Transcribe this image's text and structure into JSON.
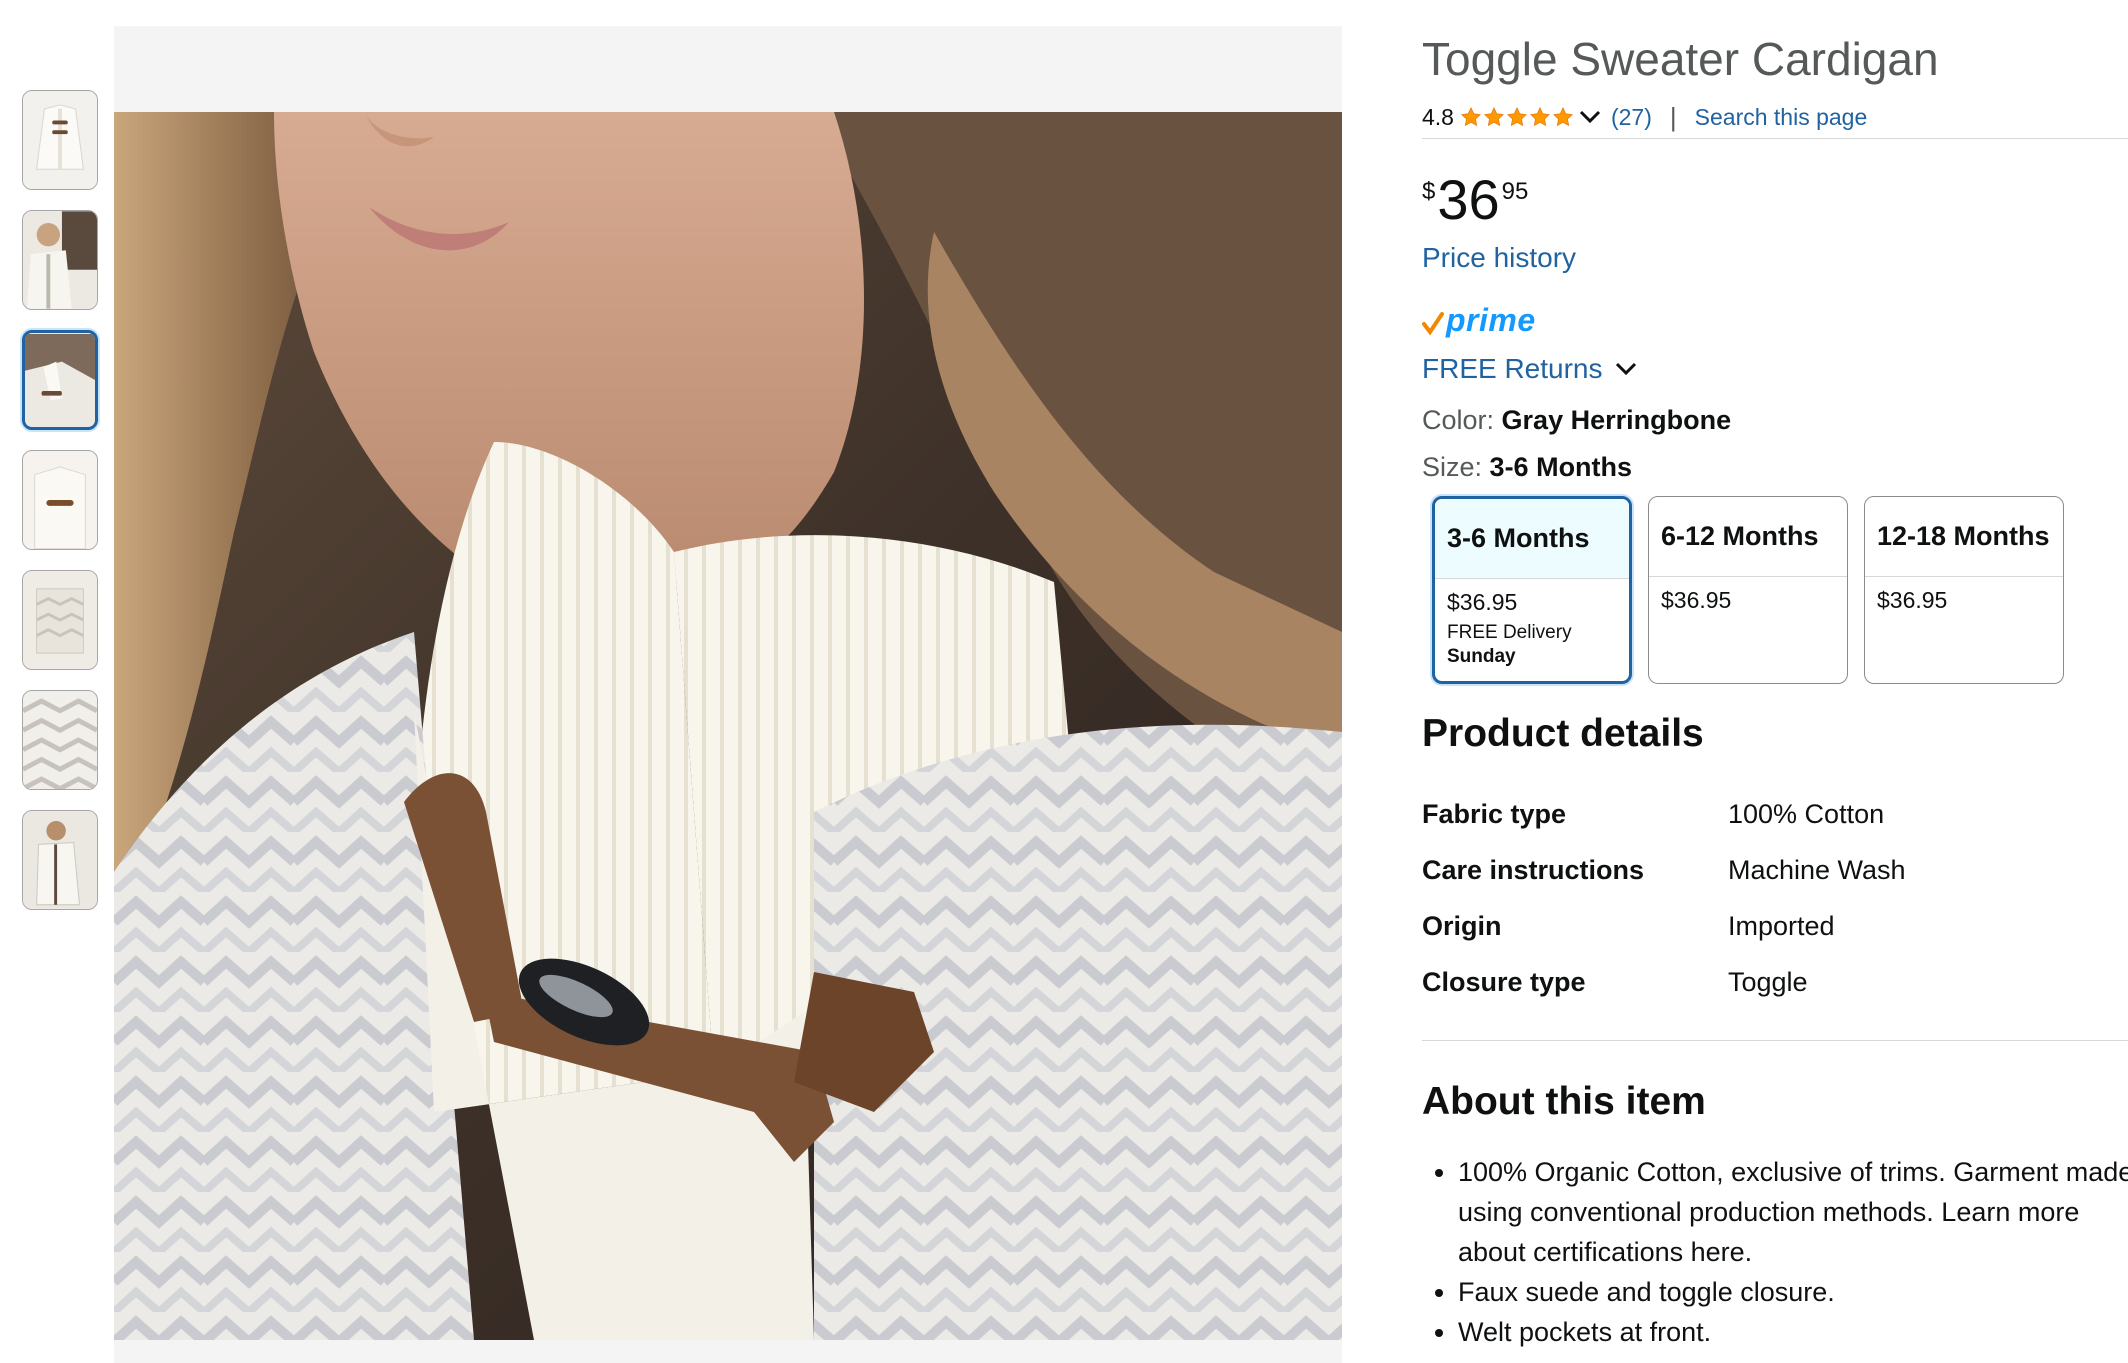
{
  "product": {
    "title": "Toggle Sweater Cardigan",
    "rating": "4.8",
    "stars": 4.8,
    "review_count": "(27)",
    "separator": "|",
    "search_page": "Search this page",
    "price_symbol": "$",
    "price_whole": "36",
    "price_fraction": "95",
    "price_history": "Price history",
    "prime": "prime",
    "free_returns": "FREE Returns",
    "color_label": "Color:",
    "color_value": "Gray Herringbone",
    "size_label": "Size:",
    "size_value": "3-6 Months"
  },
  "sizes": [
    {
      "label": "3-6 Months",
      "price": "$36.95",
      "delivery": "FREE Delivery",
      "day": "Sunday",
      "selected": true
    },
    {
      "label": "6-12 Months",
      "price": "$36.95",
      "selected": false
    },
    {
      "label": "12-18 Months",
      "price": "$36.95",
      "selected": false
    }
  ],
  "details": {
    "heading": "Product details",
    "rows": [
      {
        "key": "Fabric type",
        "value": "100% Cotton"
      },
      {
        "key": "Care instructions",
        "value": "Machine Wash"
      },
      {
        "key": "Origin",
        "value": "Imported"
      },
      {
        "key": "Closure type",
        "value": "Toggle"
      }
    ]
  },
  "about": {
    "heading": "About this item",
    "bullets": [
      "100% Organic Cotton, exclusive of trims. Garment made using conventional production methods. Learn more about certifications here.",
      "Faux suede and toggle closure.",
      "Welt pockets at front."
    ]
  },
  "thumbnails": [
    {
      "icon": "cardigan-front-thumbnail",
      "selected": false
    },
    {
      "icon": "model-wearing-thumbnail",
      "selected": false
    },
    {
      "icon": "toggle-closeup-thumbnail",
      "selected": true
    },
    {
      "icon": "collar-toggle-thumbnail",
      "selected": false
    },
    {
      "icon": "fabric-folded-thumbnail",
      "selected": false
    },
    {
      "icon": "herringbone-swatch-thumbnail",
      "selected": false
    },
    {
      "icon": "model-full-thumbnail",
      "selected": false
    }
  ],
  "colors": {
    "link": "#2162a1",
    "star": "#ff9900",
    "prime": "#1399ff",
    "selected_border": "#2162a1"
  }
}
